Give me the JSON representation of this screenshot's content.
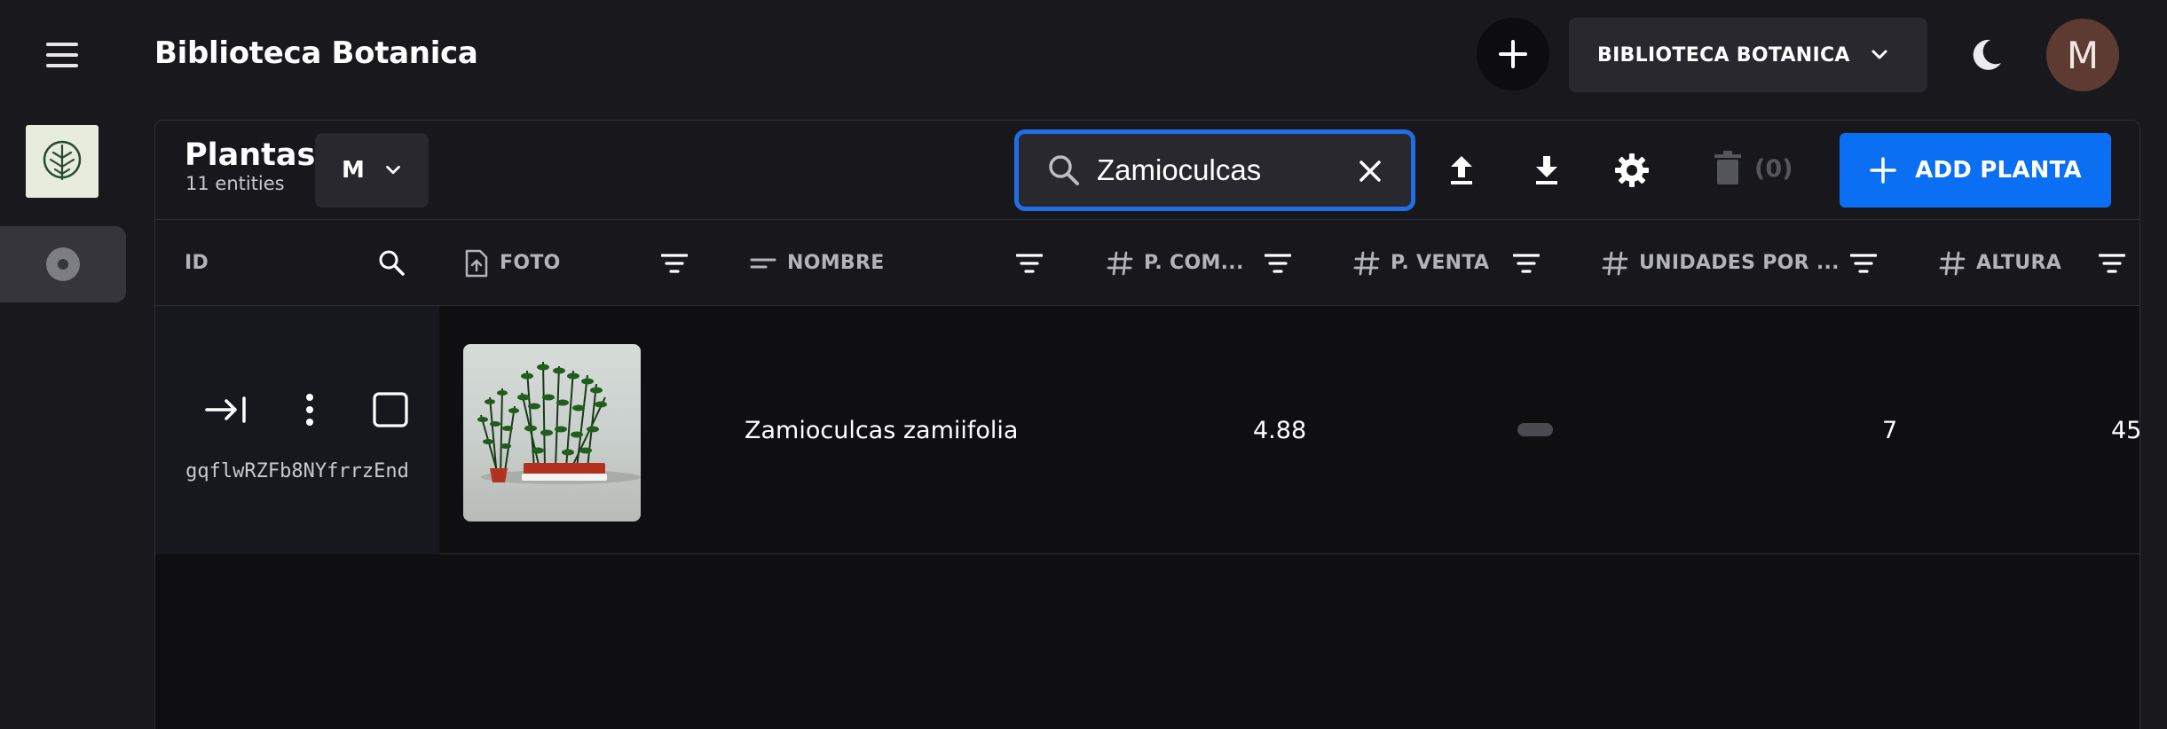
{
  "app": {
    "title": "Biblioteca Botanica",
    "project_selector": "BIBLIOTECA BOTANICA",
    "avatar_initial": "M"
  },
  "collection": {
    "title": "Plantas",
    "count_label": "11 entities",
    "size_selector": "M",
    "search": {
      "value": "Zamioculcas",
      "placeholder": "Search"
    },
    "delete_count": "(0)",
    "add_button": "ADD PLANTA"
  },
  "table": {
    "columns": [
      {
        "key": "id",
        "label": "ID",
        "icon": "search-icon"
      },
      {
        "key": "foto",
        "label": "FOTO",
        "icon": "file-upload-icon"
      },
      {
        "key": "nombre",
        "label": "NOMBRE",
        "icon": "short-text-icon"
      },
      {
        "key": "p_compra",
        "label": "P. COM...",
        "icon": "hash-icon"
      },
      {
        "key": "p_venta",
        "label": "P. VENTA",
        "icon": "hash-icon"
      },
      {
        "key": "unidades",
        "label": "UNIDADES POR ...",
        "icon": "hash-icon"
      },
      {
        "key": "altura",
        "label": "ALTURA",
        "icon": "hash-icon"
      }
    ],
    "rows": [
      {
        "id": "gqflwRZFb8NYfrrzEnd",
        "nombre": "Zamioculcas zamiifolia",
        "p_compra": "4.88",
        "p_venta": "",
        "unidades": "7",
        "altura": "45"
      }
    ]
  },
  "colors": {
    "background": "#18181d",
    "accent": "#0a6ff3",
    "search_focus": "#1f6ee8",
    "avatar": "#5d3b32"
  }
}
